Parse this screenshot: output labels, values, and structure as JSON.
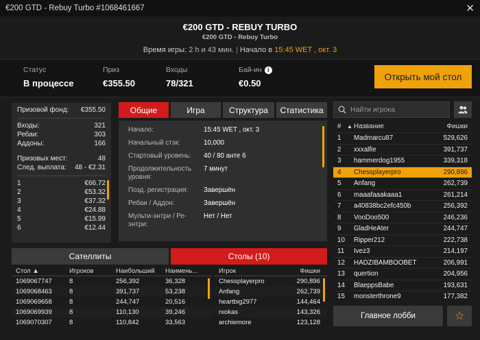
{
  "window": {
    "title": "€200 GTD - Rebuy Turbo #1068461667"
  },
  "header": {
    "title": "€200 GTD - REBUY TURBO",
    "subtitle": "€200 GTD - Rebuy Turbo",
    "time_label": "Время игры:",
    "time_value": "2 h и 43 мин.",
    "start_label": "Начало в",
    "start_value": "15:45 WET , окт. 3"
  },
  "info": {
    "status_label": "Статус",
    "status_value": "В процессе",
    "prize_label": "Приз",
    "prize_value": "€355.50",
    "entries_label": "Входы",
    "entries_value": "78/321",
    "buyin_label": "Бай-ин",
    "buyin_value": "€0.50",
    "open_table": "Открыть мой стол"
  },
  "prize_panel": {
    "fund_label": "Призовой фонд:",
    "fund_value": "€355.50",
    "entries_label": "Входы:",
    "entries_value": "321",
    "rebuys_label": "Ребаи:",
    "rebuys_value": "303",
    "addons_label": "Аддоны:",
    "addons_value": "166",
    "places_label": "Призовых мест:",
    "places_value": "48",
    "next_label": "След. выплата:",
    "next_value": "48 - €2.31",
    "payouts": [
      {
        "place": "1",
        "amount": "€66.72"
      },
      {
        "place": "2",
        "amount": "€53.32"
      },
      {
        "place": "3",
        "amount": "€37.32"
      },
      {
        "place": "4",
        "amount": "€24.88"
      },
      {
        "place": "5",
        "amount": "€15.99"
      },
      {
        "place": "6",
        "amount": "€12.44"
      }
    ]
  },
  "tabs": [
    "Общие",
    "Игра",
    "Структура",
    "Статистика"
  ],
  "details": [
    {
      "k": "Начало:",
      "v": "15:45 WET , окт. 3"
    },
    {
      "k": "Начальный стэк:",
      "v": "10,000"
    },
    {
      "k": "Стартовый уровень:",
      "v": "40 / 80 анте 6"
    },
    {
      "k": "Продолжительность уровня:",
      "v": "7 минут"
    },
    {
      "k": "Позд. регистрация:",
      "v": "Завершён"
    },
    {
      "k": "Ребаи / Аддон:",
      "v": "Завершён"
    },
    {
      "k": "Мульти-энтри / Ре-энтри:",
      "v": "Нет / Нет"
    }
  ],
  "bottom_tabs": {
    "satellites": "Сателлиты",
    "tables": "Столы (10)"
  },
  "tables_list": {
    "headers": [
      "Стол ▲",
      "Игроков",
      "Наибольший",
      "Наимень..."
    ],
    "rows": [
      [
        "1069067747",
        "8",
        "256,392",
        "36,328"
      ],
      [
        "1069068463",
        "8",
        "391,737",
        "53,238"
      ],
      [
        "1069069658",
        "8",
        "244,747",
        "20,516"
      ],
      [
        "1069069939",
        "8",
        "110,130",
        "39,246"
      ],
      [
        "1069070307",
        "8",
        "110,842",
        "33,563"
      ]
    ]
  },
  "table_players": {
    "headers": [
      "Игрок",
      "Фишки"
    ],
    "rows": [
      [
        "Chessplayerpro",
        "290,896"
      ],
      [
        "Anfang",
        "262,739"
      ],
      [
        "heartbig2977",
        "144,464"
      ],
      [
        "rxokas",
        "143,326"
      ],
      [
        "archiemore",
        "123,128"
      ]
    ]
  },
  "search": {
    "placeholder": "Найти игрока"
  },
  "players": {
    "headers": [
      "#",
      "▲",
      "Название",
      "Фишки"
    ],
    "highlight_color": "#f0a20a",
    "rows": [
      [
        "1",
        "Madmarcu87",
        "529,626"
      ],
      [
        "2",
        "xxxalfie",
        "391,737"
      ],
      [
        "3",
        "hammerdog1955",
        "339,318"
      ],
      [
        "4",
        "Chessplayerpro",
        "290,896"
      ],
      [
        "5",
        "Anfang",
        "262,739"
      ],
      [
        "6",
        "maaafaaakaaa1",
        "261,214"
      ],
      [
        "7",
        "a40838bc2efc450b",
        "256,392"
      ],
      [
        "8",
        "VooDoo500",
        "246,236"
      ],
      [
        "9",
        "GladHeAter",
        "244,747"
      ],
      [
        "10",
        "Ripper212",
        "222,738"
      ],
      [
        "11",
        "Ivez3",
        "214,197"
      ],
      [
        "12",
        "HADZIBAMBOOBET",
        "206,991"
      ],
      [
        "13",
        "quertion",
        "204,956"
      ],
      [
        "14",
        "BlaeppsBabe",
        "193,631"
      ],
      [
        "15",
        "monsterthrone9",
        "177,382"
      ]
    ]
  },
  "footer": {
    "main_lobby": "Главное лобби"
  }
}
